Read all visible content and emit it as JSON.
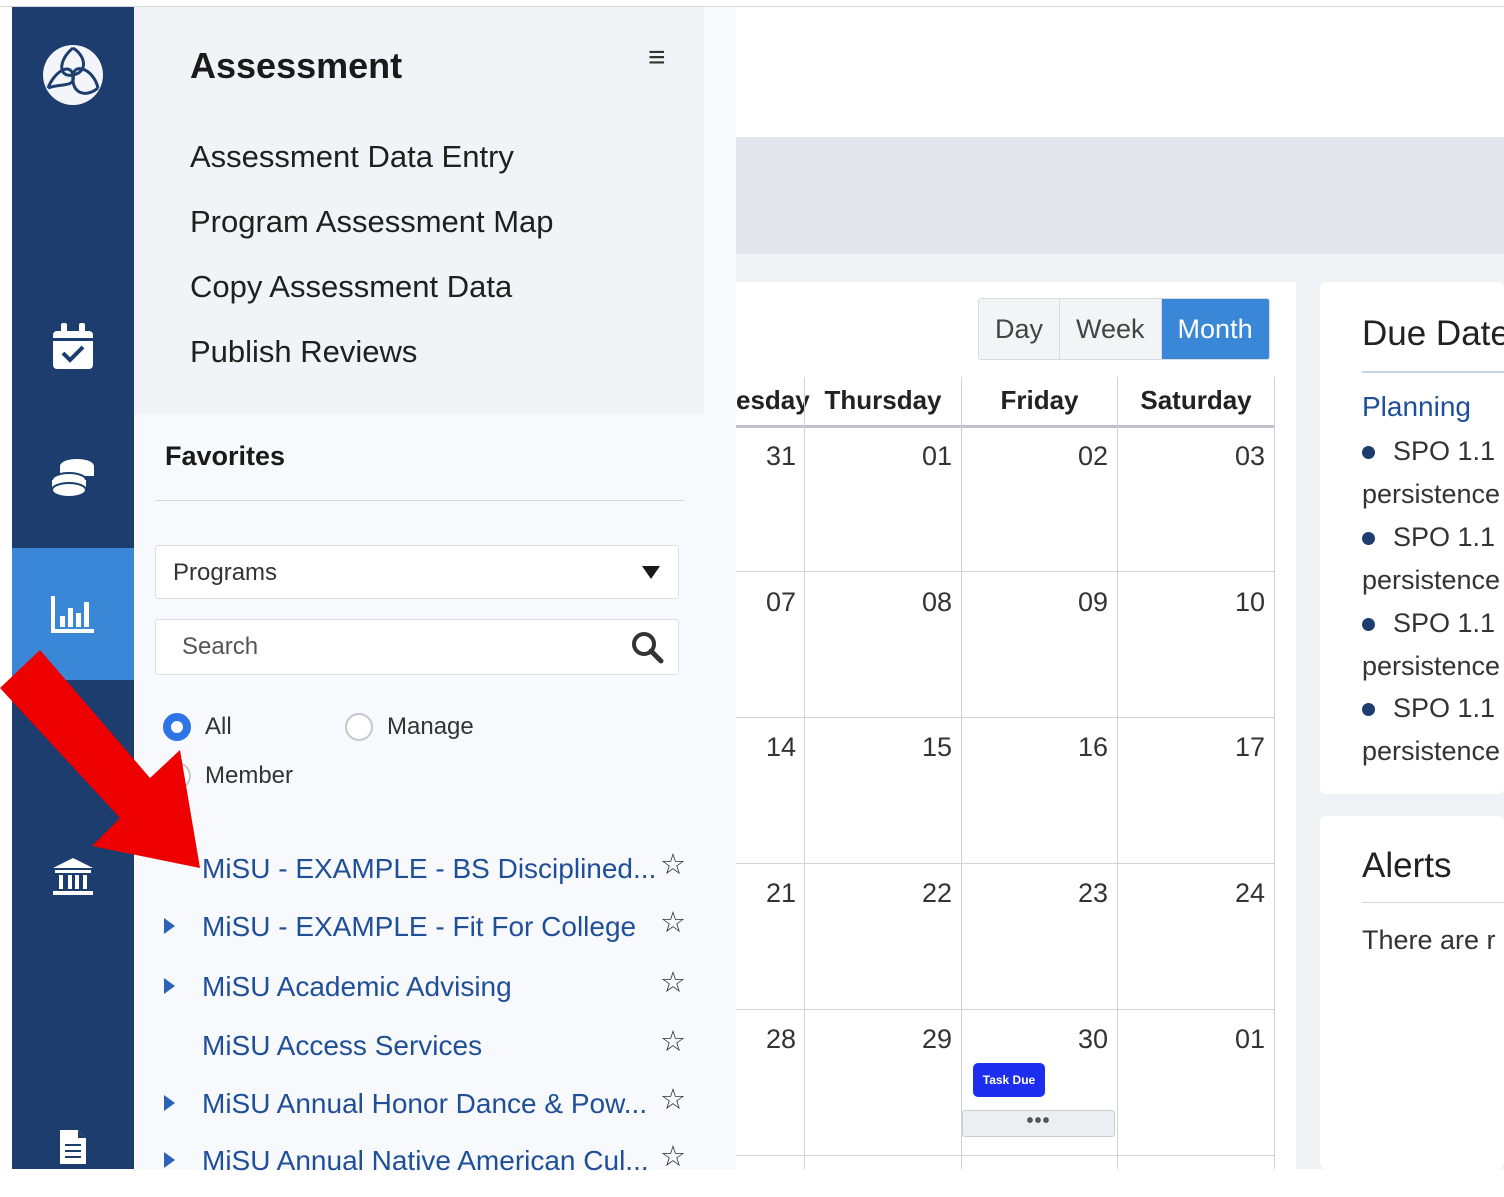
{
  "menu": {
    "title": "Assessment",
    "links": [
      "Assessment Data Entry",
      "Program Assessment Map",
      "Copy Assessment Data",
      "Publish Reviews"
    ]
  },
  "favorites": {
    "title": "Favorites",
    "select_value": "Programs",
    "search_placeholder": "Search",
    "radios": [
      {
        "label": "All",
        "checked": true
      },
      {
        "label": "Manage",
        "checked": false
      },
      {
        "label": "Member",
        "checked": false
      }
    ],
    "programs": [
      {
        "name": "MiSU - EXAMPLE - BS Disciplined...",
        "expandable": false
      },
      {
        "name": "MiSU - EXAMPLE - Fit For College",
        "expandable": true
      },
      {
        "name": "MiSU Academic Advising",
        "expandable": true
      },
      {
        "name": "MiSU Access Services",
        "expandable": false
      },
      {
        "name": "MiSU Annual Honor Dance & Pow...",
        "expandable": true
      },
      {
        "name": "MiSU Annual Native American Cul...",
        "expandable": true
      }
    ]
  },
  "calendar": {
    "views": [
      "Day",
      "Week",
      "Month"
    ],
    "active_view": "Month",
    "day_headers": [
      "esday",
      "Thursday",
      "Friday",
      "Saturday"
    ],
    "weeks": [
      [
        "31",
        "01",
        "02",
        "03"
      ],
      [
        "07",
        "08",
        "09",
        "10"
      ],
      [
        "14",
        "15",
        "16",
        "17"
      ],
      [
        "21",
        "22",
        "23",
        "24"
      ],
      [
        "28",
        "29",
        "30",
        "01"
      ]
    ],
    "event_label": "Task Due",
    "more_label": "•••"
  },
  "due_dates": {
    "title": "Due Date",
    "section": "Planning",
    "items": [
      "SPO 1.1",
      "SPO 1.1",
      "SPO 1.1",
      "SPO 1.1"
    ],
    "item_sub": "persistence"
  },
  "alerts": {
    "title": "Alerts",
    "text": "There are r"
  },
  "colors": {
    "rail": "#1c3d6e",
    "active": "#3a87d8",
    "link": "#1f4f99",
    "annotation_arrow": "#ee0000"
  }
}
